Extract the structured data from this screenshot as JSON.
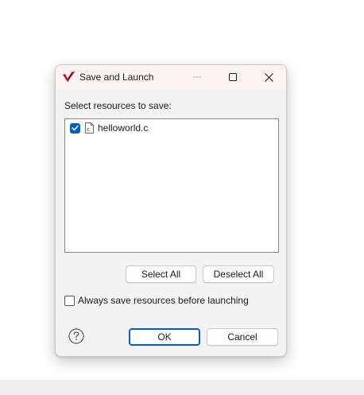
{
  "dialog": {
    "title": "Save and Launch",
    "prompt": "Select resources to save:",
    "resources": [
      {
        "name": "helloworld.c",
        "checked": true,
        "icon": "c-file-icon"
      }
    ],
    "select_all_label": "Select All",
    "deselect_all_label": "Deselect All",
    "always_save_label": "Always save resources before launching",
    "always_save_checked": false,
    "ok_label": "OK",
    "cancel_label": "Cancel"
  },
  "colors": {
    "accent": "#005fb8",
    "titlebar_bg": "#fbf4f2",
    "dialog_bg": "#f3f3f3",
    "app_icon_red": "#c8102e"
  }
}
